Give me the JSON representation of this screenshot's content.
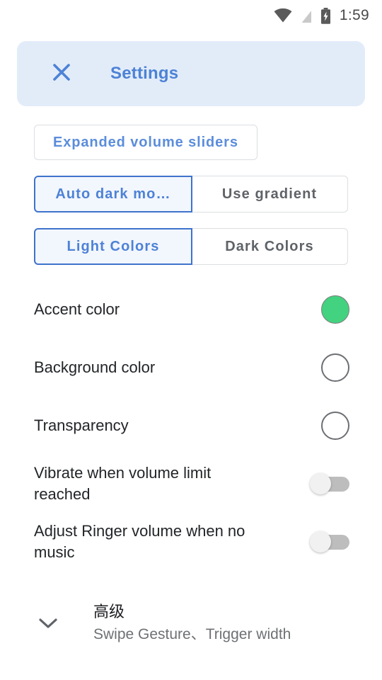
{
  "statusbar": {
    "time": "1:59",
    "icons": [
      "wifi-icon",
      "signal-off-icon",
      "battery-charging-icon"
    ]
  },
  "header": {
    "close_icon": "close-icon",
    "title": "Settings",
    "background": "#e2ecf9",
    "accent": "#4d82d6"
  },
  "buttons": {
    "expanded_volume_sliders": "Expanded volume sliders"
  },
  "segments": [
    {
      "name": "dark-mode-segment",
      "options": [
        {
          "label": "Auto dark mo…",
          "selected": true
        },
        {
          "label": "Use gradient",
          "selected": false
        }
      ]
    },
    {
      "name": "color-scheme-segment",
      "options": [
        {
          "label": "Light Colors",
          "selected": true
        },
        {
          "label": "Dark Colors",
          "selected": false
        }
      ]
    }
  ],
  "rows": [
    {
      "label": "Accent color",
      "control": "color-swatch",
      "color": "#43d27f",
      "filled": true
    },
    {
      "label": "Background color",
      "control": "color-swatch",
      "color": "#ffffff",
      "filled": false
    },
    {
      "label": "Transparency",
      "control": "color-swatch",
      "color": "#ffffff",
      "filled": false
    },
    {
      "label": "Vibrate when volume limit reached",
      "control": "toggle",
      "on": false
    },
    {
      "label": "Adjust Ringer volume when no music",
      "control": "toggle",
      "on": false
    }
  ],
  "advanced": {
    "chevron_icon": "chevron-down-icon",
    "title": "高级",
    "subtitle": "Swipe Gesture、Trigger width"
  },
  "colors": {
    "accent_green": "#43d27f",
    "link_blue": "#4d82d6",
    "border_gray": "#dcdee1",
    "text_dark": "#222528",
    "text_gray": "#5f6368"
  }
}
